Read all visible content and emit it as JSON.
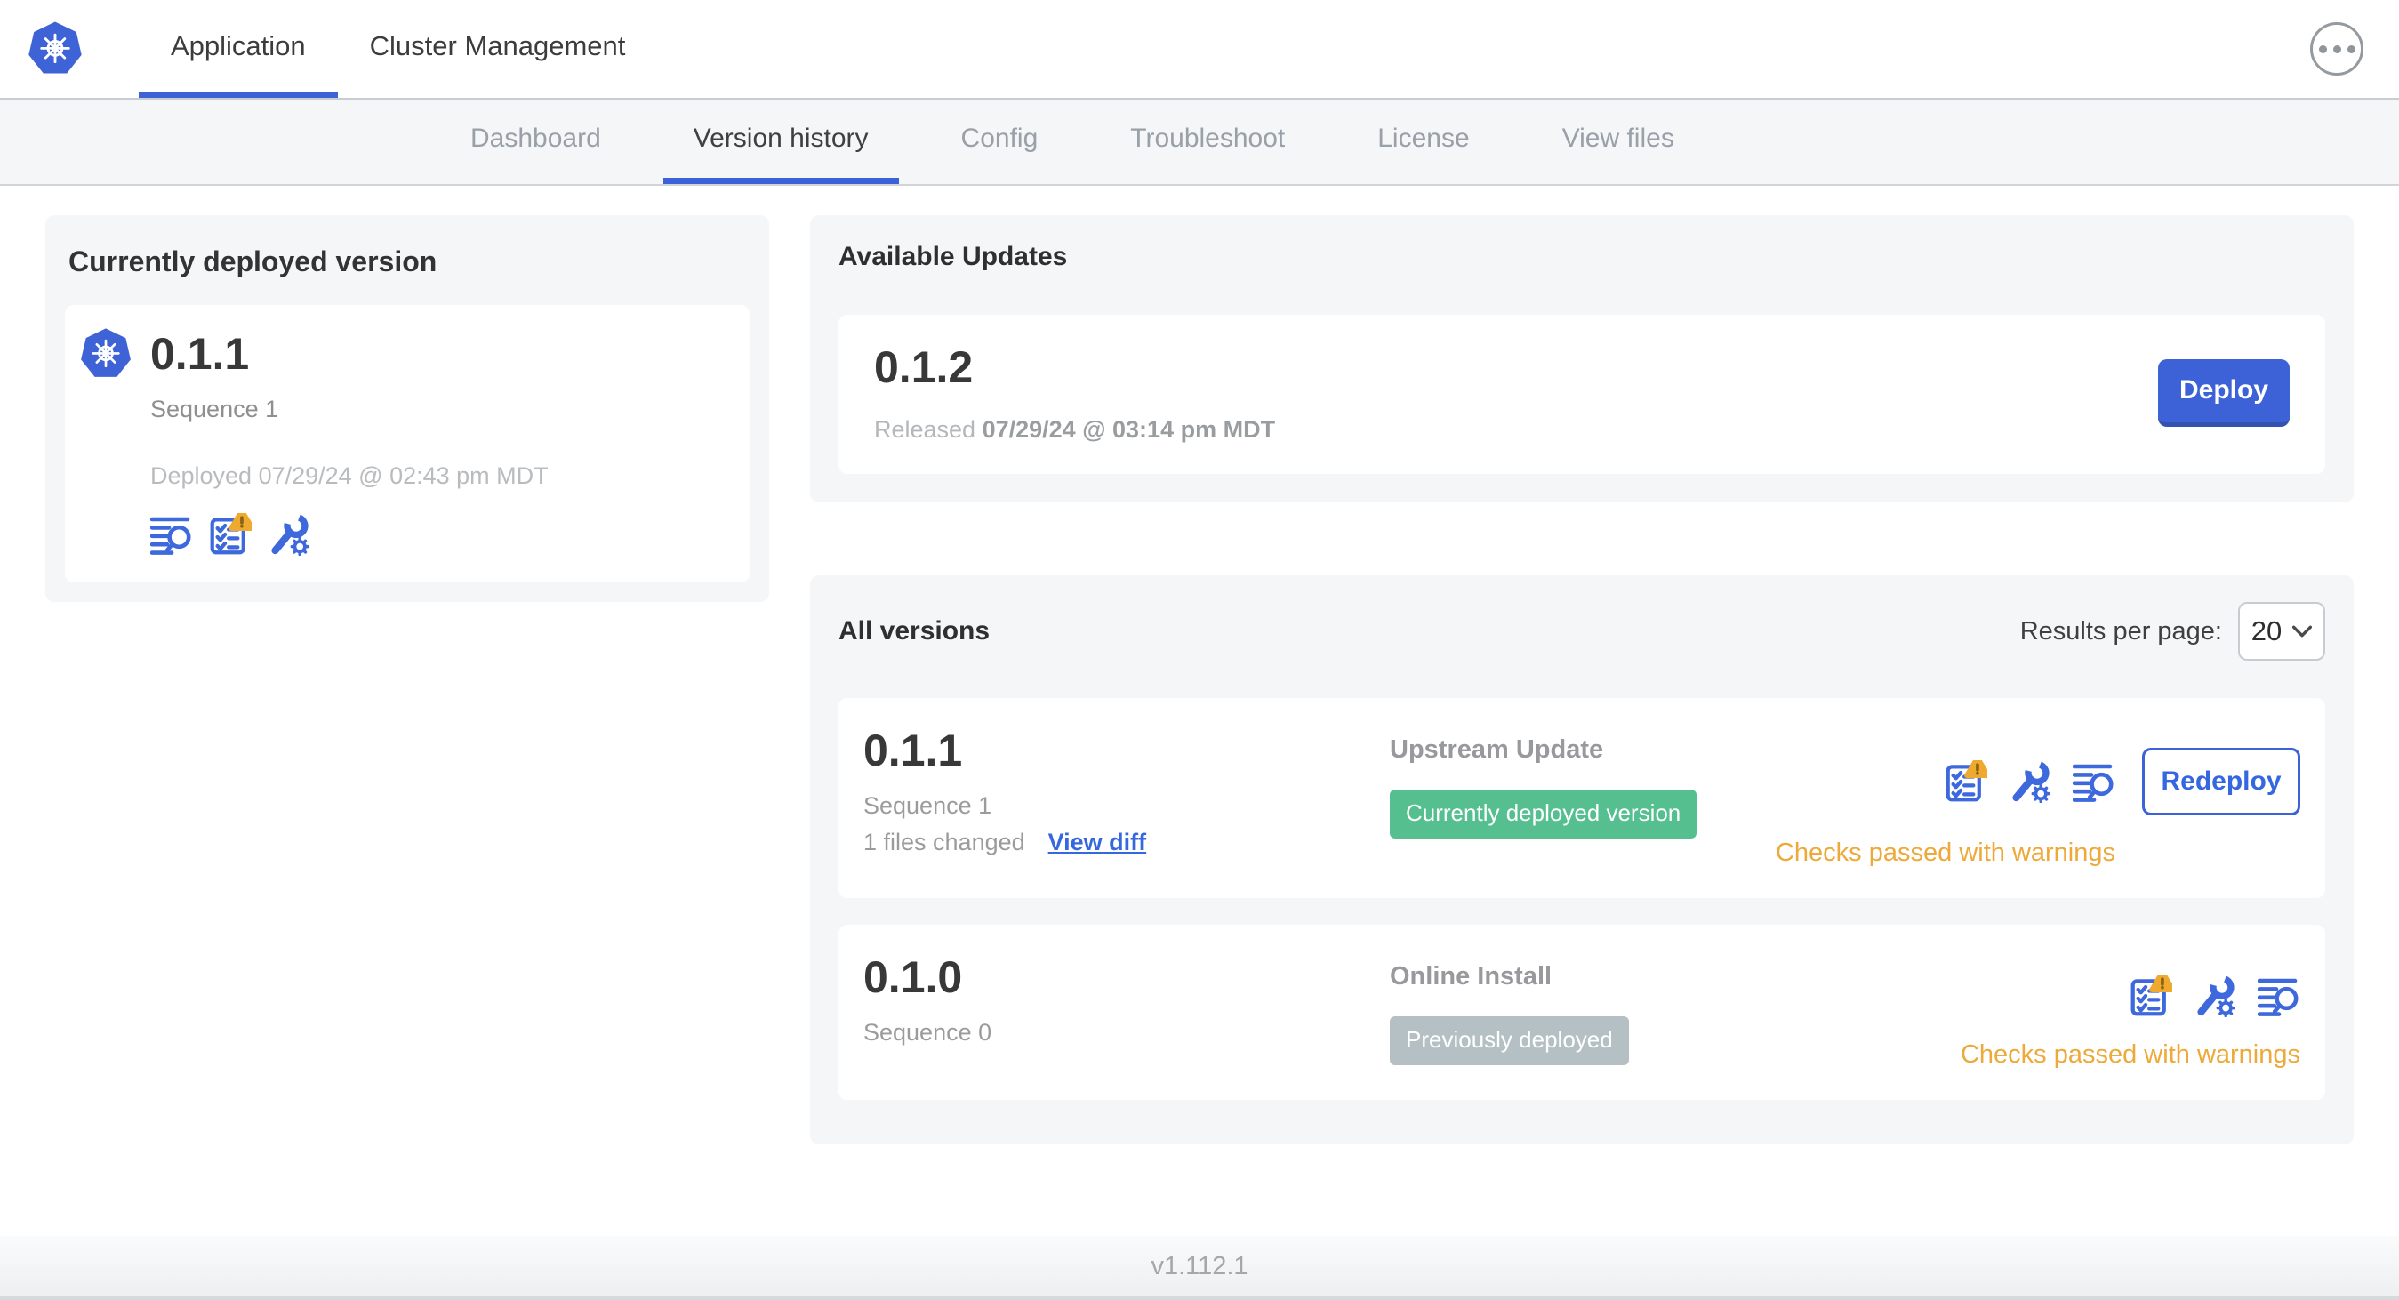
{
  "topbar": {
    "tabs": [
      {
        "label": "Application",
        "active": true
      },
      {
        "label": "Cluster Management",
        "active": false
      }
    ]
  },
  "subnav": {
    "items": [
      {
        "label": "Dashboard",
        "active": false
      },
      {
        "label": "Version history",
        "active": true
      },
      {
        "label": "Config",
        "active": false
      },
      {
        "label": "Troubleshoot",
        "active": false
      },
      {
        "label": "License",
        "active": false
      },
      {
        "label": "View files",
        "active": false
      }
    ]
  },
  "currently_deployed": {
    "title": "Currently deployed version",
    "version": "0.1.1",
    "sequence": "Sequence 1",
    "deployed_at": "Deployed 07/29/24 @ 02:43 pm MDT",
    "icons": [
      "diff-logs-icon",
      "preflight-checks-warning-icon",
      "config-icon"
    ]
  },
  "available_updates": {
    "title": "Available Updates",
    "update": {
      "version": "0.1.2",
      "released_label": "Released",
      "released_at": "07/29/24 @ 03:14 pm MDT",
      "deploy_label": "Deploy"
    }
  },
  "all_versions": {
    "title": "All versions",
    "results_per_page_label": "Results per page:",
    "results_per_page_value": "20",
    "rows": [
      {
        "version": "0.1.1",
        "sequence": "Sequence 1",
        "files_changed": "1 files changed",
        "view_diff_label": "View diff",
        "source": "Upstream Update",
        "badge": "Currently deployed version",
        "badge_style": "green",
        "icons": [
          "preflight-checks-warning-icon",
          "config-icon",
          "diff-logs-icon"
        ],
        "action_label": "Redeploy",
        "status": "Checks passed with warnings"
      },
      {
        "version": "0.1.0",
        "sequence": "Sequence 0",
        "source": "Online Install",
        "badge": "Previously deployed",
        "badge_style": "gray",
        "icons": [
          "preflight-checks-warning-icon",
          "config-icon",
          "diff-logs-icon"
        ],
        "status": "Checks passed with warnings"
      }
    ]
  },
  "footer": {
    "version": "v1.112.1"
  },
  "colors": {
    "primary_blue": "#3d62d8",
    "link_blue": "#3567e0",
    "logo_blue": "#3e63d6",
    "badge_green": "#55bf90",
    "badge_gray": "#b4c0c3",
    "warning_amber": "#edaa3b",
    "card_bg": "#f4f6f8"
  }
}
